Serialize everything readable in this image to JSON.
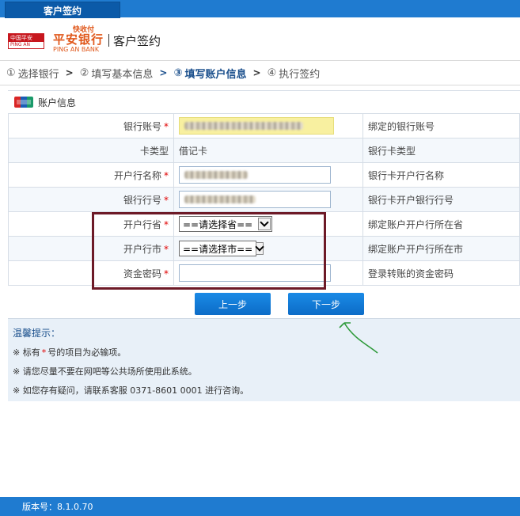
{
  "window": {
    "tab_title": "客户签约"
  },
  "brand": {
    "badge_text": "中国平安",
    "badge_sub": "PING AN",
    "tagline": "快收付",
    "name_cn": "平安银行",
    "name_en": "PING AN BANK",
    "page_title": "客户签约"
  },
  "steps": [
    {
      "num": "①",
      "label": "选择银行",
      "current": false
    },
    {
      "num": "②",
      "label": "填写基本信息",
      "current": false
    },
    {
      "num": "③",
      "label": "填写账户信息",
      "current": true
    },
    {
      "num": "④",
      "label": "执行签约",
      "current": false
    }
  ],
  "step_separator": ">",
  "section": {
    "title": "账户信息",
    "icon": "unionpay-card-icon"
  },
  "form": {
    "rows": [
      {
        "label": "银行账号",
        "required": true,
        "field_type": "text-blurred-highlighted",
        "desc": "绑定的银行账号"
      },
      {
        "label": "卡类型",
        "required": false,
        "field_type": "static",
        "value": "借记卡",
        "desc": "银行卡类型"
      },
      {
        "label": "开户行名称",
        "required": true,
        "field_type": "text-blurred",
        "desc": "银行卡开户行名称"
      },
      {
        "label": "银行行号",
        "required": true,
        "field_type": "text-blurred",
        "desc": "银行卡开户银行行号"
      },
      {
        "label": "开户行省",
        "required": true,
        "field_type": "select",
        "value": "==请选择省==",
        "desc": "绑定账户开户行所在省"
      },
      {
        "label": "开户行市",
        "required": true,
        "field_type": "select",
        "value": "==请选择市==",
        "desc": "绑定账户开户行所在市"
      },
      {
        "label": "资金密码",
        "required": true,
        "field_type": "password",
        "value": "",
        "desc": "登录转账的资金密码"
      }
    ],
    "required_mark": "*"
  },
  "buttons": {
    "prev": "上一步",
    "next": "下一步"
  },
  "tips": {
    "title": "温馨提示：",
    "line1_prefix": "※ 标有",
    "line1_suffix": "号的项目为必输项。",
    "line2": "※ 请您尽量不要在网吧等公共场所使用此系统。",
    "line3": "※ 如您存有疑问，请联系客服 0371-8601 0001 进行咨询。"
  },
  "footer": {
    "version": "版本号：8.1.0.70"
  },
  "colors": {
    "bar_blue": "#1f7bd0",
    "brand_orange": "#e0571a",
    "annotation_box": "#6d1a27",
    "annotation_arrow": "#2e9a3a",
    "required_red": "#e00000"
  }
}
